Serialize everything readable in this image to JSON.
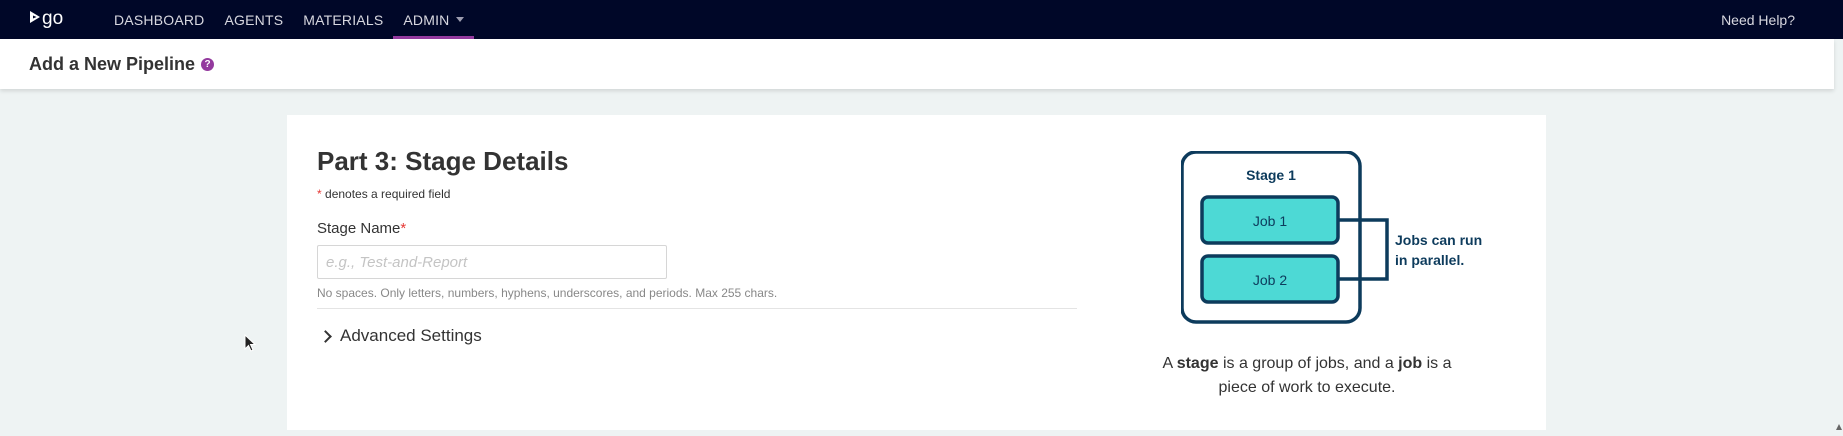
{
  "nav": {
    "logo_text": "go",
    "items": [
      "DASHBOARD",
      "AGENTS",
      "MATERIALS",
      "ADMIN"
    ],
    "help": "Need Help?"
  },
  "header": {
    "title": "Add a New Pipeline",
    "help_glyph": "?"
  },
  "form": {
    "title": "Part 3: Stage Details",
    "required_star": "*",
    "required_note": "denotes a required field",
    "stage_name_label": "Stage Name",
    "stage_name_placeholder": "e.g., Test-and-Report",
    "stage_name_value": "",
    "stage_name_hint": "No spaces. Only letters, numbers, hyphens, underscores, and periods. Max 255 chars.",
    "advanced_settings": "Advanced Settings"
  },
  "diagram": {
    "stage_label": "Stage 1",
    "job1_label": "Job 1",
    "job2_label": "Job 2",
    "parallel_line1": "Jobs can run",
    "parallel_line2": "in parallel."
  },
  "explanation": {
    "p1": "A ",
    "stage": "stage",
    "p2": " is a group of jobs, and a ",
    "job": "job",
    "p3": " is a piece of work to execute."
  },
  "colors": {
    "topbar": "#000728",
    "accent": "#943a9e",
    "job_fill": "#4dd9d5",
    "diagram_stroke": "#0d3b5c"
  }
}
